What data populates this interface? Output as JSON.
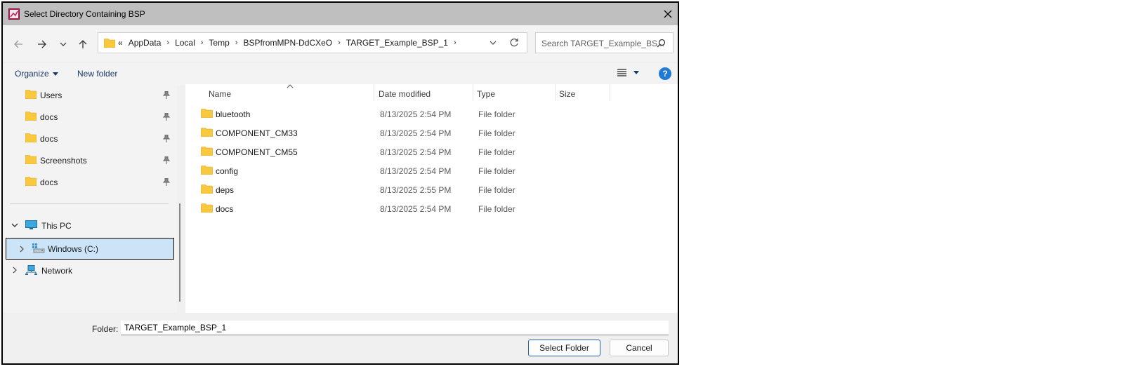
{
  "window": {
    "title": "Select Directory Containing BSP",
    "colors": {
      "titlebar": "#bfbfbf",
      "accent": "#1e7ad6",
      "folder": "#f8c93e",
      "selection": "#cce4f7"
    }
  },
  "navigation": {
    "back_icon": "arrow-left-icon",
    "forward_icon": "arrow-right-icon",
    "recent_icon": "chevron-down-icon",
    "up_icon": "arrow-up-icon"
  },
  "address": {
    "overflow": "«",
    "crumbs": [
      "AppData",
      "Local",
      "Temp",
      "BSPfromMPN-DdCXeO",
      "TARGET_Example_BSP_1"
    ],
    "separator": "›"
  },
  "search": {
    "placeholder": "Search TARGET_Example_BS..."
  },
  "toolbar": {
    "organize": "Organize",
    "new_folder": "New folder"
  },
  "sidebar": {
    "quick_access": [
      {
        "label": "Users"
      },
      {
        "label": "docs"
      },
      {
        "label": "docs"
      },
      {
        "label": "Screenshots"
      },
      {
        "label": "docs"
      }
    ],
    "this_pc": "This PC",
    "windows_c": "Windows (C:)",
    "network": "Network"
  },
  "file_list": {
    "columns": [
      "Name",
      "Date modified",
      "Type",
      "Size"
    ],
    "rows": [
      {
        "name": "bluetooth",
        "date": "8/13/2025 2:54 PM",
        "type": "File folder"
      },
      {
        "name": "COMPONENT_CM33",
        "date": "8/13/2025 2:54 PM",
        "type": "File folder"
      },
      {
        "name": "COMPONENT_CM55",
        "date": "8/13/2025 2:54 PM",
        "type": "File folder"
      },
      {
        "name": "config",
        "date": "8/13/2025 2:54 PM",
        "type": "File folder"
      },
      {
        "name": "deps",
        "date": "8/13/2025 2:55 PM",
        "type": "File folder"
      },
      {
        "name": "docs",
        "date": "8/13/2025 2:54 PM",
        "type": "File folder"
      }
    ]
  },
  "footer": {
    "folder_label": "Folder:",
    "folder_value": "TARGET_Example_BSP_1",
    "select_button": "Select Folder",
    "cancel_button": "Cancel"
  }
}
